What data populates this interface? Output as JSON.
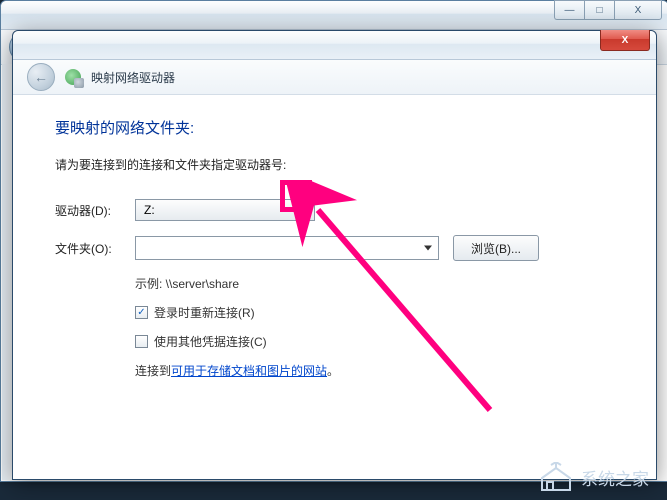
{
  "outer": {
    "controls": {
      "min_glyph": "—",
      "max_glyph": "□",
      "close_glyph": "X"
    }
  },
  "dialog": {
    "close_glyph": "X",
    "header": {
      "back_glyph": "←",
      "title": "映射网络驱动器"
    },
    "heading": "要映射的网络文件夹:",
    "instruction": "请为要连接到的连接和文件夹指定驱动器号:",
    "drive": {
      "label": "驱动器(D):",
      "value": "Z:"
    },
    "folder": {
      "label": "文件夹(O):",
      "value": "",
      "browse_label": "浏览(B)..."
    },
    "example": "示例: \\\\server\\share",
    "reconnect": {
      "checked": "✓",
      "label": "登录时重新连接(R)"
    },
    "othercred": {
      "checked": "",
      "label": "使用其他凭据连接(C)"
    },
    "link": {
      "prefix": "连接到",
      "text": "可用于存储文档和图片的网站",
      "suffix": "。"
    }
  },
  "watermark": {
    "text": "系统之家"
  }
}
